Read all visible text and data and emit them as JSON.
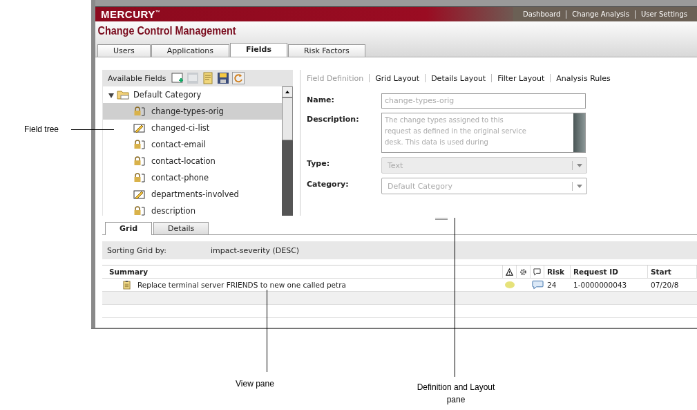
{
  "callouts": [
    {
      "label": "Field tree",
      "kind": "left"
    },
    {
      "label": "View pane",
      "kind": "view"
    },
    {
      "label": "Definition and Layout pane",
      "kind": "def"
    }
  ],
  "header": {
    "logo": "MERCURY$^{™}$",
    "nav": [
      "Dashboard",
      "Change Analysis",
      "User Settings"
    ]
  },
  "app_title": "Change Control Management",
  "tabs": [
    {
      "label": "Users",
      "selected": false
    },
    {
      "label": "Applications",
      "selected": false
    },
    {
      "label": "Fields",
      "selected": true
    },
    {
      "label": "Risk Factors",
      "selected": false
    }
  ],
  "field_tree": {
    "title": "Available Fields",
    "category": {
      "label": "Default Category",
      "expanded": true,
      "children": [
        {
          "label": "change-types-orig",
          "kind": "lock",
          "selected": true
        },
        {
          "label": "changed-ci-list",
          "kind": "pencil",
          "selected": false
        },
        {
          "label": "contact-email",
          "kind": "lock",
          "selected": false
        },
        {
          "label": "contact-location",
          "kind": "lock",
          "selected": false
        },
        {
          "label": "contact-phone",
          "kind": "lock",
          "selected": false
        },
        {
          "label": "departments-involved",
          "kind": "pencil",
          "selected": false
        },
        {
          "label": "description",
          "kind": "lock",
          "selected": false
        }
      ]
    }
  },
  "definition_links": [
    {
      "label": "Field Definition",
      "selected": true
    },
    {
      "label": "Grid Layout",
      "selected": false
    },
    {
      "label": "Details Layout",
      "selected": false
    },
    {
      "label": "Filter Layout",
      "selected": false
    },
    {
      "label": "Analysis Rules",
      "selected": false
    }
  ],
  "form": [
    {
      "label": "Name:",
      "kind": "input",
      "value": "change-types-orig"
    },
    {
      "label": "Description:",
      "kind": "textarea",
      "value": "The change types assigned to this request as defined in the original service desk. This data is used during"
    },
    {
      "label": "Type:",
      "kind": "select",
      "value": "Text",
      "disabled": true
    },
    {
      "label": "Category:",
      "kind": "select",
      "value": "Default Category",
      "disabled": false
    }
  ],
  "view_tabs": [
    {
      "label": "Grid",
      "selected": true
    },
    {
      "label": "Details",
      "selected": false
    }
  ],
  "sorting": {
    "label": "Sorting Grid by:",
    "value": "impact-severity (DESC)"
  },
  "grid": {
    "columns": [
      {
        "label": "Summary",
        "kind": "text"
      },
      {
        "kind": "warning"
      },
      {
        "kind": "gear"
      },
      {
        "kind": "comment"
      },
      {
        "label": "Risk",
        "kind": "text"
      },
      {
        "label": "Request ID",
        "kind": "text"
      },
      {
        "label": "Start",
        "kind": "text"
      }
    ],
    "rows": [
      {
        "summary": "Replace terminal server FRIENDS to new one called petra",
        "status_indicator": true,
        "comment": true,
        "risk": "24",
        "request_id": "1-0000000043",
        "start": "07/20/8"
      }
    ]
  }
}
